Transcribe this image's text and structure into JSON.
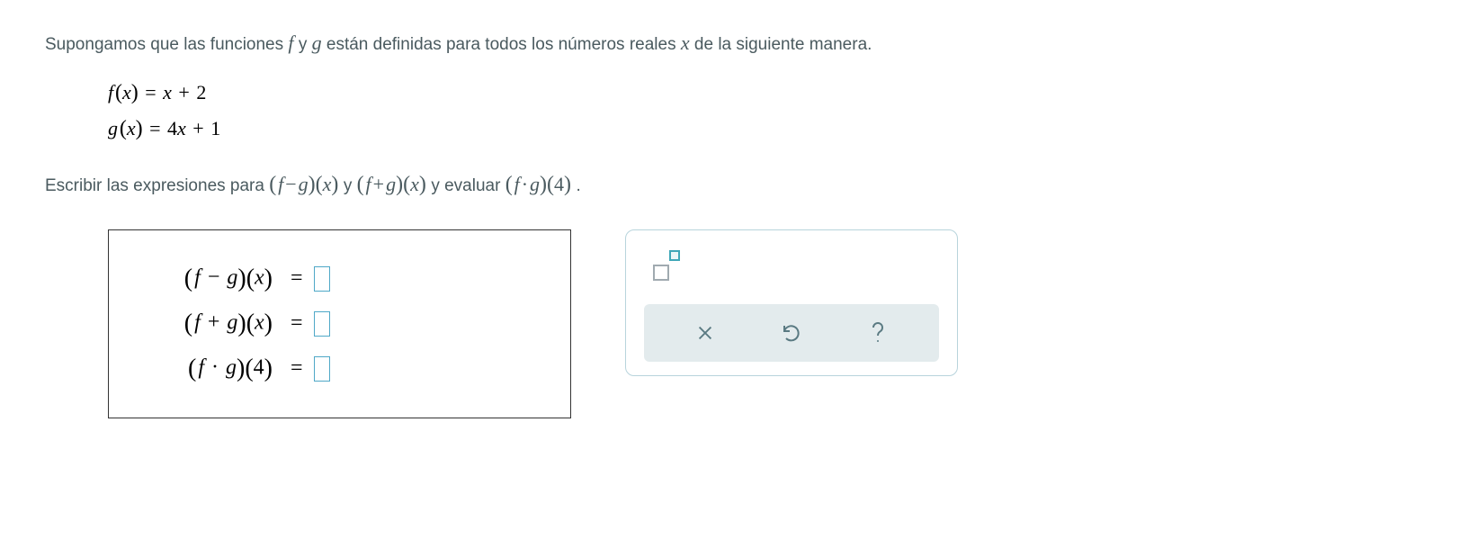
{
  "intro": {
    "p1": "Supongamos que las funciones ",
    "f": "f",
    "conj": " y ",
    "g": "g",
    "p2": " están definidas para todos los números reales ",
    "x": "x",
    "p3": " de la siguiente manera."
  },
  "defs": {
    "f_lhs_fn": "f",
    "f_lhs_var": "x",
    "f_rhs_a": "x",
    "f_rhs_op": "+",
    "f_rhs_b": "2",
    "g_lhs_fn": "g",
    "g_lhs_var": "x",
    "g_rhs_a": "4",
    "g_rhs_b": "x",
    "g_rhs_op": "+",
    "g_rhs_c": "1"
  },
  "instr": {
    "p1": "Escribir las expresiones para ",
    "e1a": "f",
    "e1op": "−",
    "e1b": "g",
    "e1arg": "x",
    "conj1": " y ",
    "e2a": "f",
    "e2op": "+",
    "e2b": "g",
    "e2arg": "x",
    "p2": " y evaluar ",
    "e3a": "f",
    "e3op": "·",
    "e3b": "g",
    "e3arg": "4",
    "p3": "."
  },
  "answers": {
    "row1": {
      "a": "f",
      "op": "−",
      "b": "g",
      "arg": "x"
    },
    "row2": {
      "a": "f",
      "op": "+",
      "b": "g",
      "arg": "x"
    },
    "row3": {
      "a": "f",
      "op": "·",
      "b": "g",
      "arg": "4"
    }
  },
  "eq_sign": "="
}
